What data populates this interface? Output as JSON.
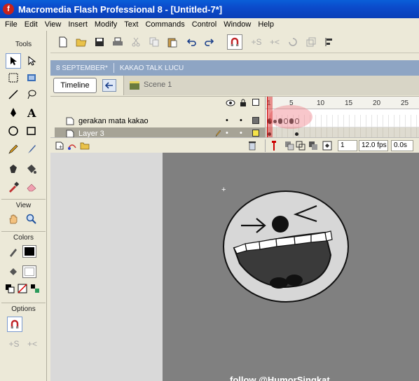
{
  "window": {
    "title": "Macromedia Flash Professional 8 - [Untitled-7*]",
    "logo_letter": "f"
  },
  "menubar": {
    "items": [
      "File",
      "Edit",
      "View",
      "Insert",
      "Modify",
      "Text",
      "Commands",
      "Control",
      "Window",
      "Help"
    ]
  },
  "tools_panel": {
    "tools_label": "Tools",
    "view_label": "View",
    "colors_label": "Colors",
    "options_label": "Options",
    "stroke_color": "#000000",
    "fill_color": "#ffffff"
  },
  "document_tabs": [
    "8 SEPTEMBER*",
    "KAKAO TALK LUCU"
  ],
  "timeline_header": {
    "timeline_button": "Timeline",
    "scene_label": "Scene 1"
  },
  "timeline": {
    "ruler_numbers": [
      "1",
      "5",
      "10",
      "15",
      "20",
      "25"
    ],
    "layers": [
      {
        "name": "gerakan mata kakao"
      },
      {
        "name": "Layer 3"
      }
    ],
    "current_frame": "1",
    "frame_rate": "12.0 fps",
    "elapsed_time": "0.0s"
  },
  "stage": {
    "watermark": "follow @HumorSingkat"
  },
  "colors": {
    "title_bar": "#0b4bcb",
    "stage": "#808080",
    "work_area": "#d9d9d9",
    "doc_tabs": "#8ea5c4"
  }
}
